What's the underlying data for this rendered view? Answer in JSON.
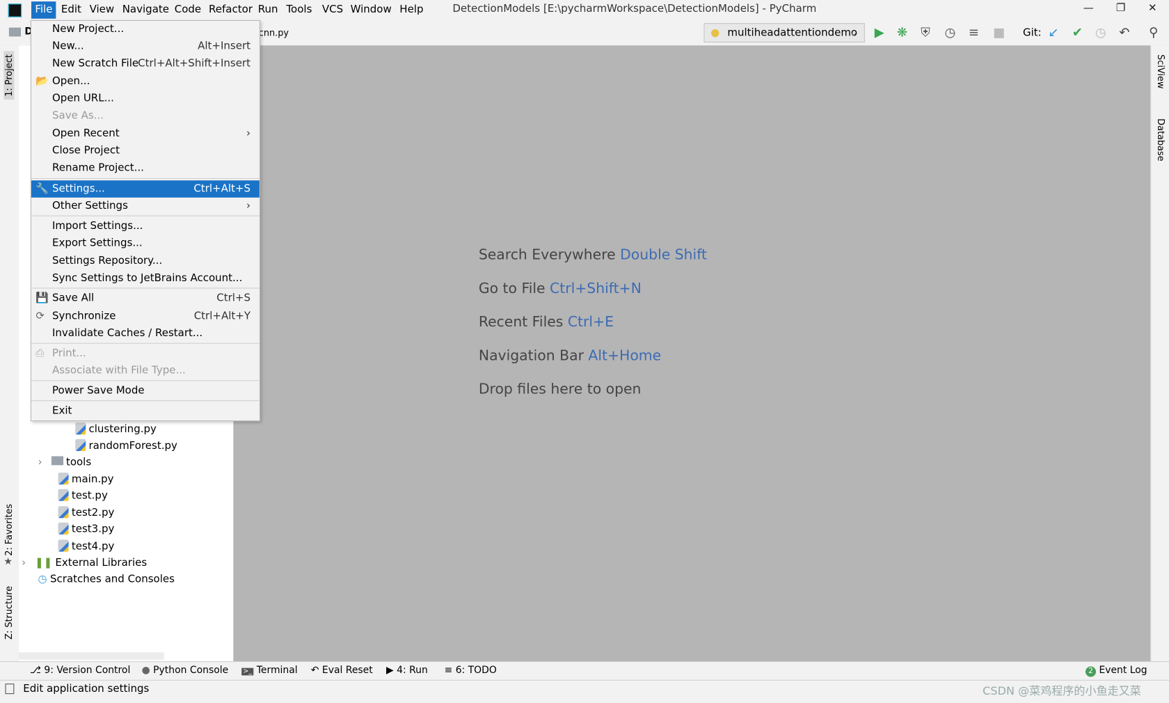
{
  "title_bar": {
    "menu": [
      "File",
      "Edit",
      "View",
      "Navigate",
      "Code",
      "Refactor",
      "Run",
      "Tools",
      "VCS",
      "Window",
      "Help"
    ],
    "window_title": "DetectionModels [E:\\pycharmWorkspace\\DetectionModels] - PyCharm"
  },
  "nav": {
    "project_crumb": "D",
    "file_tab": "cnn.py",
    "run_config": "multiheadattentiondemo",
    "git_label": "Git:"
  },
  "side_tabs": {
    "project": "1: Project",
    "favorites": "2: Favorites",
    "structure": "Z: Structure",
    "sciview": "SciView",
    "database": "Database"
  },
  "file_menu": {
    "items": [
      {
        "label": "New Project...",
        "shortcut": ""
      },
      {
        "label": "New...",
        "shortcut": "Alt+Insert"
      },
      {
        "label": "New Scratch File",
        "shortcut": "Ctrl+Alt+Shift+Insert"
      },
      {
        "label": "Open...",
        "shortcut": ""
      },
      {
        "label": "Open URL...",
        "shortcut": ""
      },
      {
        "label": "Save As...",
        "shortcut": ""
      },
      {
        "label": "Open Recent",
        "shortcut": ""
      },
      {
        "label": "Close Project",
        "shortcut": ""
      },
      {
        "label": "Rename Project...",
        "shortcut": ""
      },
      {
        "label": "Settings...",
        "shortcut": "Ctrl+Alt+S"
      },
      {
        "label": "Other Settings",
        "shortcut": ""
      },
      {
        "label": "Import Settings...",
        "shortcut": ""
      },
      {
        "label": "Export Settings...",
        "shortcut": ""
      },
      {
        "label": "Settings Repository...",
        "shortcut": ""
      },
      {
        "label": "Sync Settings to JetBrains Account...",
        "shortcut": ""
      },
      {
        "label": "Save All",
        "shortcut": "Ctrl+S"
      },
      {
        "label": "Synchronize",
        "shortcut": "Ctrl+Alt+Y"
      },
      {
        "label": "Invalidate Caches / Restart...",
        "shortcut": ""
      },
      {
        "label": "Print...",
        "shortcut": ""
      },
      {
        "label": "Associate with File Type...",
        "shortcut": ""
      },
      {
        "label": "Power Save Mode",
        "shortcut": ""
      },
      {
        "label": "Exit",
        "shortcut": ""
      }
    ]
  },
  "project_tree": [
    "clustering.py",
    "randomForest.py",
    "tools",
    "main.py",
    "test.py",
    "test2.py",
    "test3.py",
    "test4.py",
    "External Libraries",
    "Scratches and Consoles"
  ],
  "editor_hints": [
    {
      "text": "Search Everywhere",
      "key": "Double Shift"
    },
    {
      "text": "Go to File",
      "key": "Ctrl+Shift+N"
    },
    {
      "text": "Recent Files",
      "key": "Ctrl+E"
    },
    {
      "text": "Navigation Bar",
      "key": "Alt+Home"
    },
    {
      "text": "Drop files here to open",
      "key": ""
    }
  ],
  "bottom_tools": [
    "9: Version Control",
    "Python Console",
    "Terminal",
    "Eval Reset",
    "4: Run",
    "6: TODO",
    "Event Log"
  ],
  "event_log_count": "2",
  "status": {
    "text": "Edit application settings",
    "watermark": "CSDN @菜鸡程序的小鱼走又菜"
  },
  "colors": {
    "accent": "#1a73c7",
    "editor_bg": "#b5b5b5",
    "hint_key": "#3d6bb3"
  }
}
